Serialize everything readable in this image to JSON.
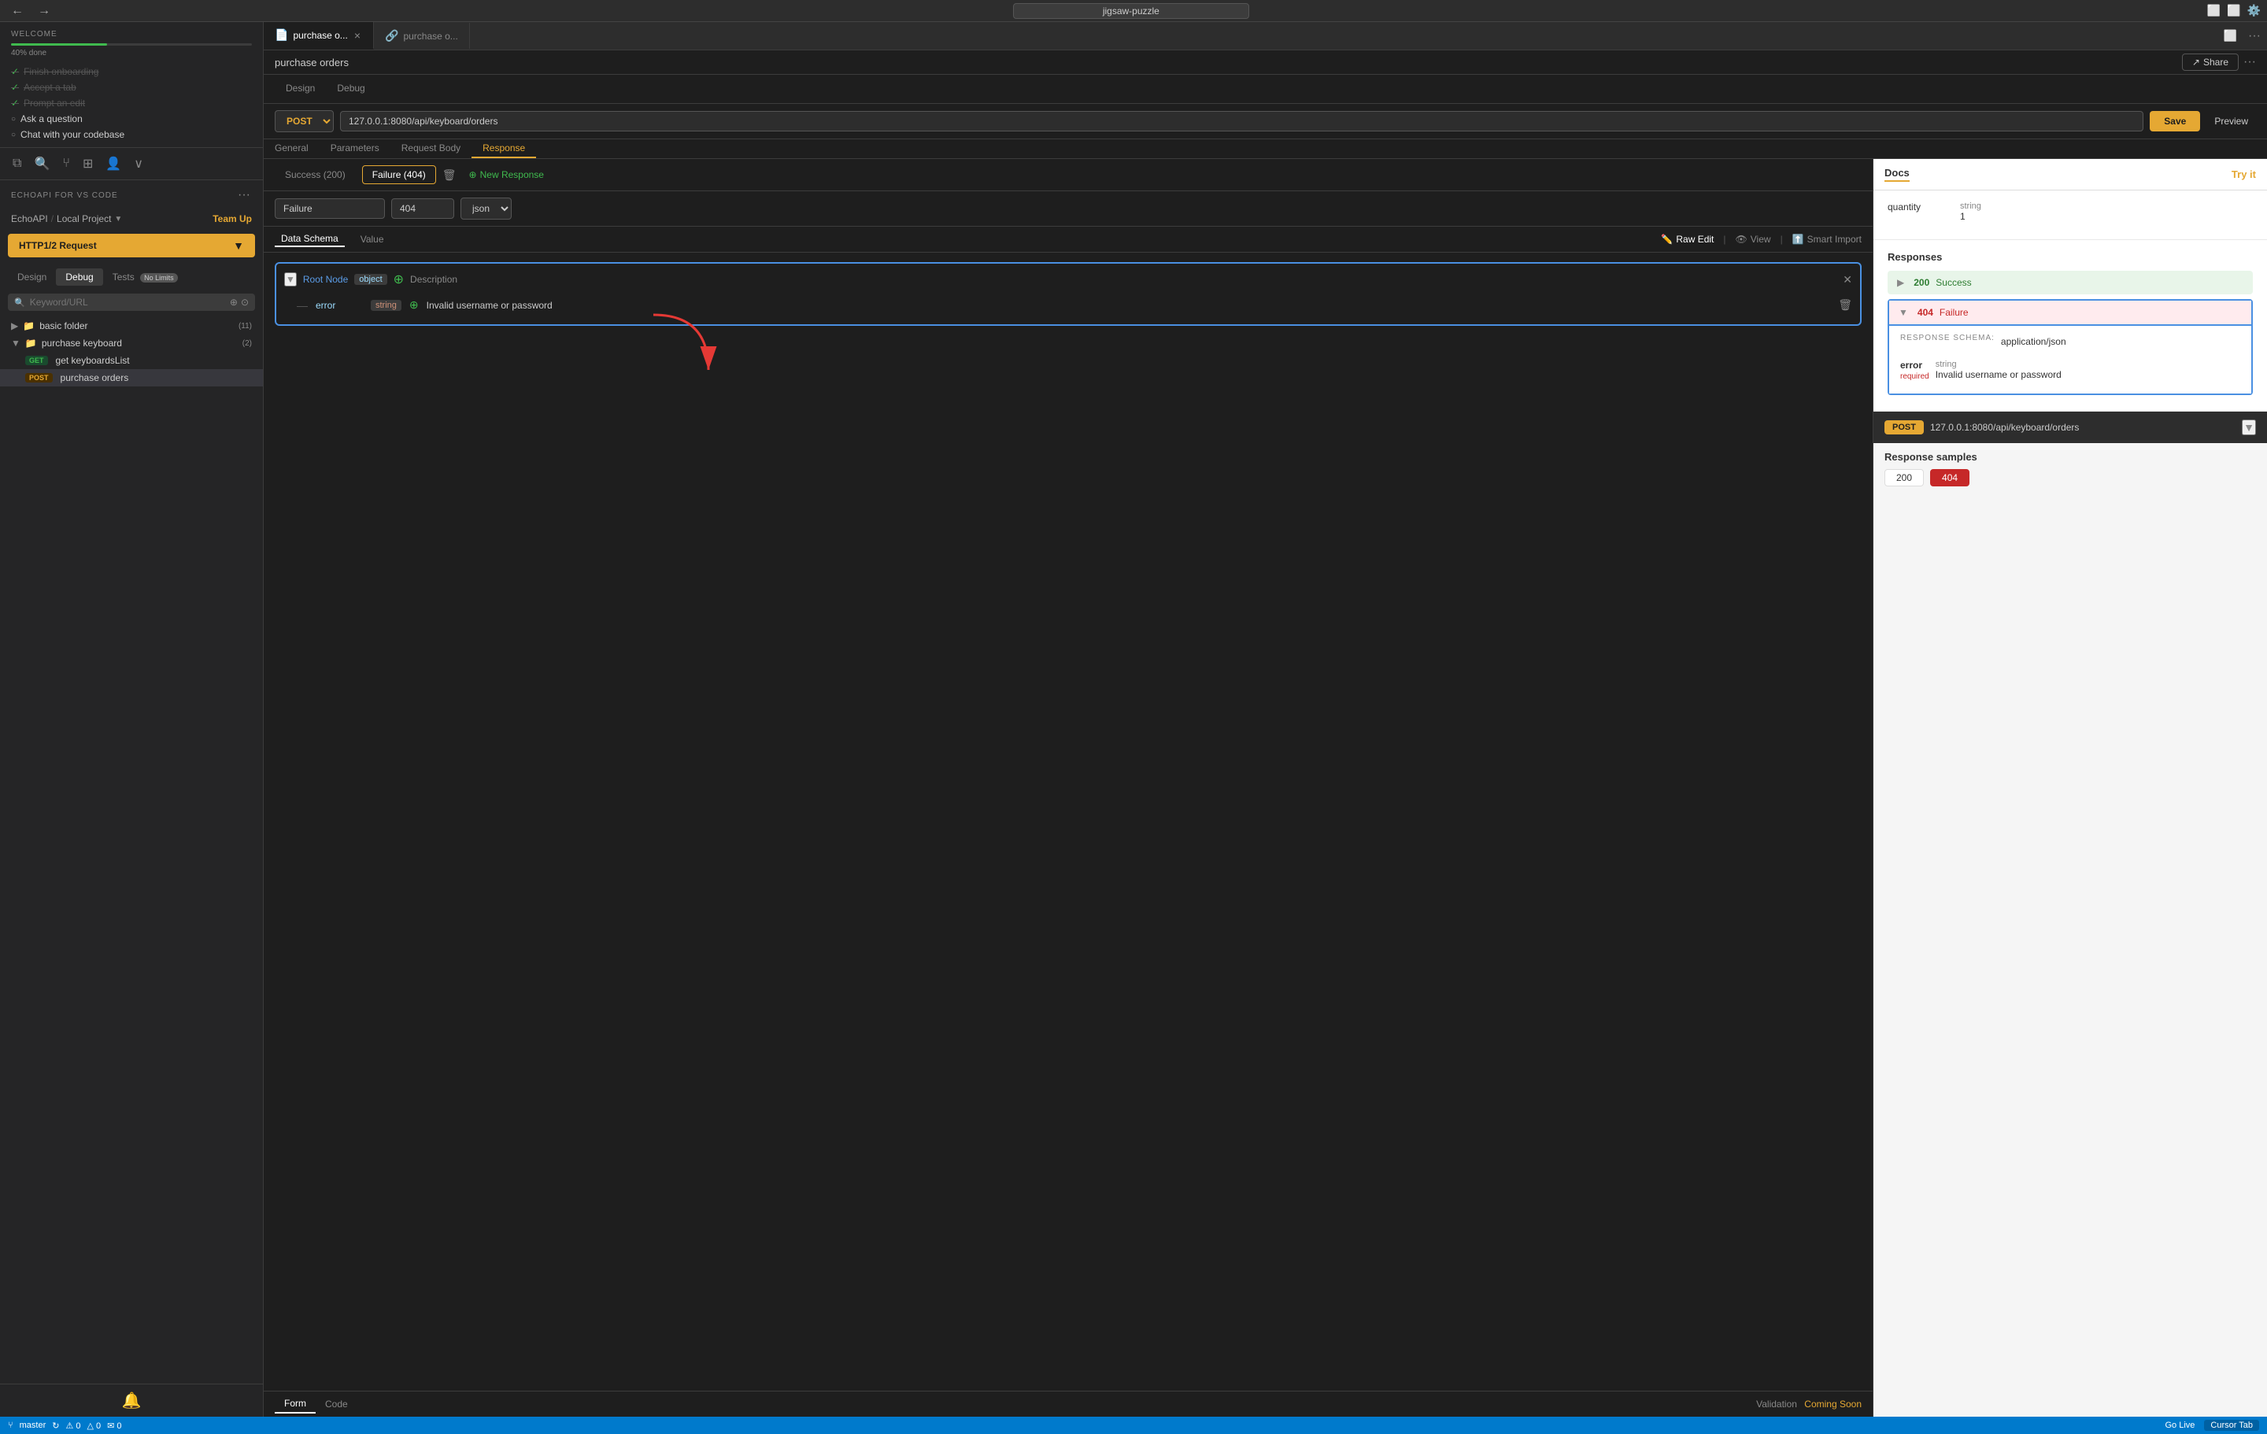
{
  "topbar": {
    "url": "jigsaw-puzzle"
  },
  "sidebar": {
    "welcome_title": "WELCOME",
    "progress_pct": 40,
    "progress_text": "40% done",
    "checklist": [
      {
        "label": "Finish onboarding",
        "done": true
      },
      {
        "label": "Accept a tab",
        "done": true
      },
      {
        "label": "Prompt an edit",
        "done": true,
        "strikethrough": true
      },
      {
        "label": "Ask a question",
        "done": false
      },
      {
        "label": "Chat with your codebase",
        "done": false
      }
    ],
    "section_title": "ECHOAPI FOR VS CODE",
    "breadcrumb_root": "EchoAPI",
    "breadcrumb_project": "Local Project",
    "team_up_label": "Team Up",
    "http_request_label": "HTTP1/2 Request",
    "tabs": [
      {
        "label": "Design",
        "active": false
      },
      {
        "label": "Debug",
        "active": false
      },
      {
        "label": "Tests",
        "active": false,
        "badge": "No Limits"
      }
    ],
    "search_placeholder": "Keyword/URL",
    "folders": [
      {
        "label": "basic folder",
        "count": "(11)",
        "expanded": false
      },
      {
        "label": "purchase keyboard",
        "count": "(2)",
        "expanded": true,
        "children": [
          {
            "method": "GET",
            "label": "get keyboardsList"
          },
          {
            "method": "POST",
            "label": "purchase orders",
            "active": true
          }
        ]
      }
    ]
  },
  "tabs": [
    {
      "label": "purchase o...",
      "icon": "📄",
      "active": true,
      "closable": true
    },
    {
      "label": "purchase o...",
      "icon": "🔗",
      "active": false,
      "closable": false
    }
  ],
  "page_title": "purchase orders",
  "share_label": "Share",
  "toolbar": {
    "design_tab": "Design",
    "debug_tab": "Debug",
    "method": "POST",
    "url": "127.0.0.1:8080/api/keyboard/orders",
    "save_label": "Save",
    "preview_label": "Preview"
  },
  "request_tabs": [
    {
      "label": "General"
    },
    {
      "label": "Parameters"
    },
    {
      "label": "Request Body"
    },
    {
      "label": "Response",
      "active": true
    }
  ],
  "response_tabs": [
    {
      "label": "Success",
      "code": "(200)",
      "active": false
    },
    {
      "label": "Failure",
      "code": "(404)",
      "active": true
    }
  ],
  "new_response_label": "New Response",
  "response_form": {
    "name": "Failure",
    "code": "404",
    "type": "json"
  },
  "schema_tabs": [
    {
      "label": "Data Schema",
      "active": true
    },
    {
      "label": "Value",
      "active": false
    }
  ],
  "schema_actions": [
    {
      "label": "Raw Edit",
      "icon": "✏️"
    },
    {
      "label": "View",
      "icon": "👁"
    },
    {
      "label": "Smart Import",
      "icon": "⬆️"
    }
  ],
  "schema": {
    "root_label": "Root Node",
    "root_type": "object",
    "root_desc": "Description",
    "fields": [
      {
        "name": "error",
        "type": "string",
        "value": "Invalid username or password"
      }
    ]
  },
  "docs": {
    "tab_label": "Docs",
    "try_it_label": "Try it",
    "quantity_field": "quantity",
    "quantity_type": "string",
    "quantity_value": "1",
    "responses_title": "Responses",
    "response_200": {
      "code": "200",
      "label": "Success"
    },
    "response_404": {
      "code": "404",
      "label": "Failure"
    },
    "response_schema_label": "RESPONSE SCHEMA:",
    "response_schema_content_type": "application/json",
    "error_field": "error",
    "required_label": "required",
    "error_type": "string",
    "error_value": "Invalid username or password",
    "endpoint_method": "POST",
    "endpoint_url": "127.0.0.1:8080/api/keyboard/orders",
    "response_samples_title": "Response samples",
    "sample_200": "200",
    "sample_404": "404"
  },
  "bottom": {
    "form_tab": "Form",
    "code_tab": "Code",
    "validation_label": "Validation",
    "coming_soon_label": "Coming Soon"
  },
  "statusbar": {
    "branch": "master",
    "go_live": "Go Live",
    "cursor_tab": "Cursor Tab"
  }
}
